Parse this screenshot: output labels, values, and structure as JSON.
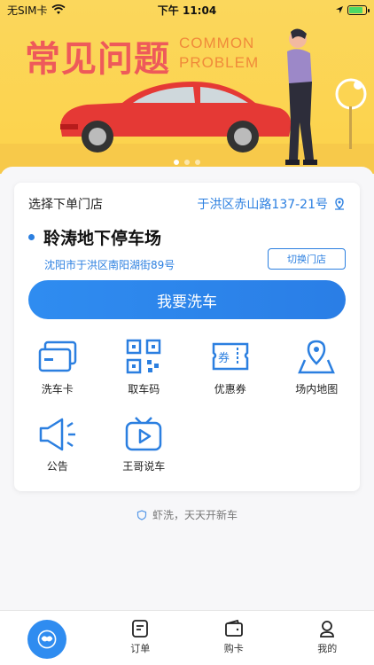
{
  "status_bar": {
    "carrier": "无SIM卡",
    "time": "下午 11:04"
  },
  "banner": {
    "title": "常见问题",
    "subtitle_line1": "COMMON",
    "subtitle_line2": "PROBLEM"
  },
  "store": {
    "label": "选择下单门店",
    "address_link": "于洪区赤山路137-21号",
    "lot_name": "聆涛地下停车场",
    "lot_address": "沈阳市于洪区南阳湖街89号",
    "switch_label": "切换门店"
  },
  "wash_button": "我要洗车",
  "grid": [
    {
      "label": "洗车卡",
      "icon": "card-icon"
    },
    {
      "label": "取车码",
      "icon": "qr-code-icon"
    },
    {
      "label": "优惠券",
      "icon": "coupon-icon"
    },
    {
      "label": "场内地图",
      "icon": "map-icon"
    },
    {
      "label": "公告",
      "icon": "megaphone-icon"
    },
    {
      "label": "王哥说车",
      "icon": "tv-icon"
    }
  ],
  "slogan": "虾洗，天天开新车",
  "tabbar": {
    "orders": "订单",
    "buy_card": "购卡",
    "mine": "我的"
  },
  "colors": {
    "accent": "#2b7fe0",
    "banner_bg": "#fcd24a",
    "banner_title": "#ee5a5a"
  }
}
